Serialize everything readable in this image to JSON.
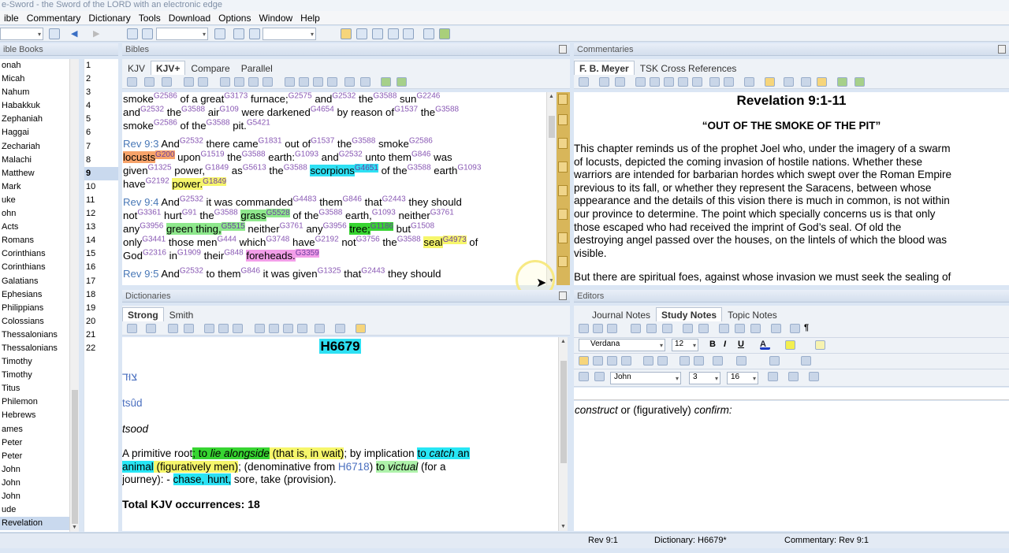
{
  "window": {
    "title": "e-Sword - the Sword of the LORD with an electronic edge"
  },
  "menu": [
    "ible",
    "Commentary",
    "Dictionary",
    "Tools",
    "Download",
    "Options",
    "Window",
    "Help"
  ],
  "books": {
    "header": "ible Books",
    "items": [
      "onah",
      "Micah",
      "Nahum",
      "Habakkuk",
      "Zephaniah",
      "Haggai",
      "Zechariah",
      "Malachi",
      "Matthew",
      "Mark",
      "uke",
      "ohn",
      "Acts",
      "Romans",
      " Corinthians",
      " Corinthians",
      "Galatians",
      "Ephesians",
      "Philippians",
      "Colossians",
      " Thessalonians",
      " Thessalonians",
      " Timothy",
      " Timothy",
      "Titus",
      "Philemon",
      "Hebrews",
      "ames",
      " Peter",
      " Peter",
      " John",
      " John",
      " John",
      "ude",
      "Revelation"
    ],
    "selected": "Revelation"
  },
  "chapters": {
    "items": [
      "1",
      "2",
      "3",
      "4",
      "5",
      "6",
      "7",
      "8",
      "9",
      "10",
      "11",
      "12",
      "13",
      "14",
      "15",
      "16",
      "17",
      "18",
      "19",
      "20",
      "21",
      "22"
    ],
    "selected": "9"
  },
  "bibles": {
    "header": "Bibles",
    "tabs": [
      "KJV",
      "KJV+",
      "Compare",
      "Parallel"
    ],
    "active_tab": "KJV+",
    "verses": [
      {
        "ref": "",
        "segs": [
          [
            "smoke",
            ""
          ],
          [
            "G2586",
            "s"
          ],
          [
            " of a great",
            ""
          ],
          [
            "G3173",
            "s"
          ],
          [
            " furnace;",
            ""
          ],
          [
            "G2575",
            "s"
          ],
          [
            " and",
            ""
          ],
          [
            "G2532",
            "s"
          ],
          [
            " the",
            ""
          ],
          [
            "G3588",
            "s"
          ],
          [
            " sun",
            ""
          ],
          [
            "G2246",
            "s"
          ],
          [
            "\nand",
            ""
          ],
          [
            "G2532",
            "s"
          ],
          [
            " the",
            ""
          ],
          [
            "G3588",
            "s"
          ],
          [
            " air",
            ""
          ],
          [
            "G109",
            "s"
          ],
          [
            " were darkened",
            ""
          ],
          [
            "G4654",
            "s"
          ],
          [
            " by reason of",
            ""
          ],
          [
            "G1537",
            "s"
          ],
          [
            " the",
            ""
          ],
          [
            "G3588",
            "s"
          ],
          [
            "\nsmoke",
            ""
          ],
          [
            "G2586",
            "s"
          ],
          [
            " of the",
            ""
          ],
          [
            "G3588",
            "s"
          ],
          [
            " pit.",
            ""
          ],
          [
            "G5421",
            "s"
          ]
        ]
      },
      {
        "ref": "Rev 9:3",
        "segs": [
          [
            "  And",
            ""
          ],
          [
            "G2532",
            "s"
          ],
          [
            " there came",
            ""
          ],
          [
            "G1831",
            "s"
          ],
          [
            " out of",
            ""
          ],
          [
            "G1537",
            "s"
          ],
          [
            " the",
            ""
          ],
          [
            "G3588",
            "s"
          ],
          [
            " smoke",
            ""
          ],
          [
            "G2586",
            "s"
          ],
          [
            "\n",
            ""
          ],
          [
            "locusts",
            "hl-o"
          ],
          [
            "G200",
            "hl-o s"
          ],
          [
            " upon",
            ""
          ],
          [
            "G1519",
            "s"
          ],
          [
            " the",
            ""
          ],
          [
            "G3588",
            "s"
          ],
          [
            " earth:",
            ""
          ],
          [
            "G1093",
            "s"
          ],
          [
            " and",
            ""
          ],
          [
            "G2532",
            "s"
          ],
          [
            " unto them",
            ""
          ],
          [
            "G846",
            "s"
          ],
          [
            " was\ngiven",
            ""
          ],
          [
            "G1325",
            "s"
          ],
          [
            " power,",
            ""
          ],
          [
            "G1849",
            "s"
          ],
          [
            " as",
            ""
          ],
          [
            "G5613",
            "s"
          ],
          [
            " the",
            ""
          ],
          [
            "G3588",
            "s"
          ],
          [
            " ",
            ""
          ],
          [
            "scorpions",
            "hl-c"
          ],
          [
            "G4651",
            "hl-c s"
          ],
          [
            " of the",
            ""
          ],
          [
            "G3588",
            "s"
          ],
          [
            " earth",
            ""
          ],
          [
            "G1093",
            "s"
          ],
          [
            "\nhave",
            ""
          ],
          [
            "G2192",
            "s"
          ],
          [
            " ",
            ""
          ],
          [
            "power.",
            "hl-y"
          ],
          [
            "G1849",
            "hl-y s"
          ]
        ]
      },
      {
        "ref": "Rev 9:4",
        "segs": [
          [
            "  And",
            ""
          ],
          [
            "G2532",
            "s"
          ],
          [
            " it was commanded",
            ""
          ],
          [
            "G4483",
            "s"
          ],
          [
            " them",
            ""
          ],
          [
            "G846",
            "s"
          ],
          [
            " that",
            ""
          ],
          [
            "G2443",
            "s"
          ],
          [
            " they should\nnot",
            ""
          ],
          [
            "G3361",
            "s"
          ],
          [
            " hurt",
            ""
          ],
          [
            "G91",
            "s"
          ],
          [
            " the",
            ""
          ],
          [
            "G3588",
            "s"
          ],
          [
            " ",
            ""
          ],
          [
            "grass",
            "hl-g"
          ],
          [
            "G5528",
            "hl-g s"
          ],
          [
            " of the",
            ""
          ],
          [
            "G3588",
            "s"
          ],
          [
            " earth,",
            ""
          ],
          [
            "G1093",
            "s"
          ],
          [
            " neither",
            ""
          ],
          [
            "G3761",
            "s"
          ],
          [
            "\nany",
            ""
          ],
          [
            "G3956",
            "s"
          ],
          [
            " ",
            ""
          ],
          [
            "green thing,",
            "hl-g"
          ],
          [
            "G5515",
            "hl-g s"
          ],
          [
            " neither",
            ""
          ],
          [
            "G3761",
            "s"
          ],
          [
            " any",
            ""
          ],
          [
            "G3956",
            "s"
          ],
          [
            " ",
            ""
          ],
          [
            "tree;",
            "hl-gg"
          ],
          [
            "G1186",
            "hl-gg s"
          ],
          [
            " but",
            ""
          ],
          [
            "G1508",
            "s"
          ],
          [
            "\nonly",
            ""
          ],
          [
            "G3441",
            "s"
          ],
          [
            " those men",
            ""
          ],
          [
            "G444",
            "s"
          ],
          [
            " which",
            ""
          ],
          [
            "G3748",
            "s"
          ],
          [
            " have",
            ""
          ],
          [
            "G2192",
            "s"
          ],
          [
            " not",
            ""
          ],
          [
            "G3756",
            "s"
          ],
          [
            " the",
            ""
          ],
          [
            "G3588",
            "s"
          ],
          [
            " ",
            ""
          ],
          [
            "seal",
            "hl-y"
          ],
          [
            "G4973",
            "hl-y s"
          ],
          [
            " of\nGod",
            ""
          ],
          [
            "G2316",
            "s"
          ],
          [
            " in",
            ""
          ],
          [
            "G1909",
            "s"
          ],
          [
            " their",
            ""
          ],
          [
            "G848",
            "s"
          ],
          [
            " ",
            ""
          ],
          [
            "foreheads.",
            "hl-p"
          ],
          [
            "G3359",
            "hl-p s"
          ]
        ]
      },
      {
        "ref": "Rev 9:5",
        "segs": [
          [
            "  And",
            ""
          ],
          [
            "G2532",
            "s"
          ],
          [
            " to them",
            ""
          ],
          [
            "G846",
            "s"
          ],
          [
            " it was given",
            ""
          ],
          [
            "G1325",
            "s"
          ],
          [
            " that",
            ""
          ],
          [
            "G2443",
            "s"
          ],
          [
            " they should",
            ""
          ]
        ]
      }
    ]
  },
  "commentaries": {
    "header": "Commentaries",
    "tabs": [
      "F. B. Meyer",
      "TSK Cross References"
    ],
    "active_tab": "F. B. Meyer",
    "title": "Revelation 9:1-11",
    "subtitle": "“OUT OF THE SMOKE OF THE PIT”",
    "paragraphs": [
      [
        "This chapter reminds us of the prophet Joel who, under the imagery of a swarm",
        "of locusts, depicted the coming invasion of hostile nations. Whether these",
        "warriors are intended for barbarian hordes which swept over the Roman Empire",
        "previous to its fall, or whether they represent the Saracens, between whose",
        "appearance and the details of this vision there is much in common, is not within",
        "our province to determine. The point which specially concerns us is that only",
        "those escaped who had received the imprint of God’s seal. Of old the",
        "destroying angel passed over the houses, on the lintels of which the blood was",
        "visible."
      ],
      [
        "But there are spiritual foes, against whose invasion we must seek the sealing of"
      ]
    ]
  },
  "dictionaries": {
    "header": "Dictionaries",
    "tabs": [
      "Strong",
      "Smith"
    ],
    "active_tab": "Strong",
    "entry": "H6679",
    "hebrew": "צוּד",
    "translit": "tsûd",
    "pronounce": "tsood",
    "def": [
      [
        "A primitive root",
        ""
      ],
      [
        "; to ",
        "hl-gg"
      ],
      [
        "lie alongside",
        "hl-gg i"
      ],
      [
        " (that is, in wait)",
        "hl-y"
      ],
      [
        "; by implication ",
        ""
      ],
      [
        "to ",
        "hl-cy"
      ],
      [
        "catch",
        "hl-cy i"
      ],
      [
        " an\nanimal",
        "hl-cy"
      ],
      [
        " (figuratively men)",
        "hl-y"
      ],
      [
        "; (denominative from ",
        ""
      ],
      [
        "H6718",
        "lnk"
      ],
      [
        ") ",
        ""
      ],
      [
        "to ",
        "hl-lg"
      ],
      [
        "victual",
        "hl-lg i"
      ],
      [
        " (for a\njourney): - ",
        ""
      ],
      [
        "chase,",
        "hl-cy"
      ],
      [
        " hunt,",
        "hl-c"
      ],
      [
        " sore, take (provision).",
        ""
      ]
    ],
    "total": "Total KJV occurrences: 18"
  },
  "editors": {
    "header": "Editors",
    "tabs": [
      "Journal Notes",
      "Study Notes",
      "Topic Notes"
    ],
    "active_tab": "Study Notes",
    "font": "Verdana",
    "size": "12",
    "author": "John",
    "num1": "3",
    "num2": "16",
    "content_i1": "construct",
    "content_mid": " or (figuratively) ",
    "content_i2": "confirm:"
  },
  "status": {
    "verse": "Rev 9:1",
    "dictionary": "Dictionary: H6679*",
    "commentary": "Commentary: Rev 9:1"
  }
}
